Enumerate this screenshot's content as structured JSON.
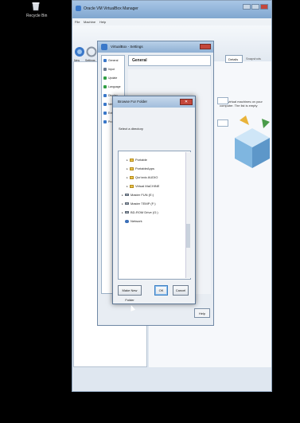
{
  "desktop": {
    "recycle_bin_label": "Recycle Bin"
  },
  "main_window": {
    "title": "Oracle VM VirtualBox Manager",
    "menu": [
      "File",
      "Machine",
      "Help"
    ],
    "toolbar": [
      {
        "label": "New",
        "icon": "new-vm-icon"
      },
      {
        "label": "Settings",
        "icon": "settings-gear-icon"
      }
    ],
    "details_tab": "Details",
    "snapshots_tab": "Snapshots",
    "welcome_text": "list of virtual machines on your computer. The list is empty"
  },
  "settings_dialog": {
    "title": "VirtualBox - Settings",
    "nav_items": [
      {
        "label": "General",
        "color": "#3a78c9"
      },
      {
        "label": "Input",
        "color": "#6a7b90"
      },
      {
        "label": "Update",
        "color": "#2f9e44"
      },
      {
        "label": "Language",
        "color": "#2f9e44"
      },
      {
        "label": "Display",
        "color": "#3a78c9"
      },
      {
        "label": "Network",
        "color": "#3a78c9"
      },
      {
        "label": "Extensions",
        "color": "#3a78c9"
      },
      {
        "label": "Proxy",
        "color": "#3a78c9"
      }
    ],
    "section_header": "General",
    "help_button": "Help"
  },
  "browse_dialog": {
    "title": "Browse For Folder",
    "prompt": "Select a directory",
    "tree": [
      {
        "label": "Portable",
        "type": "folder",
        "indent": 1
      },
      {
        "label": "PortableApps",
        "type": "folder",
        "indent": 1
      },
      {
        "label": "Qur'anic AUDIO",
        "type": "folder",
        "indent": 1
      },
      {
        "label": "Virtual MaCHINE",
        "type": "folder",
        "indent": 1
      },
      {
        "label": "Master FUN (E:)",
        "type": "drive",
        "indent": 0
      },
      {
        "label": "Master TEMP (F:)",
        "type": "drive",
        "indent": 0
      },
      {
        "label": "BD-ROM Drive (G:)",
        "type": "drive",
        "indent": 0
      },
      {
        "label": "Network",
        "type": "network",
        "indent": 0
      }
    ],
    "make_new_folder_button": "Make New Folder",
    "ok_button": "OK",
    "cancel_button": "Cancel"
  },
  "colors": {
    "desktop_bg": "#000000",
    "titlebar": "#8fb0d4",
    "close_red": "#c4473b",
    "folder_yellow": "#e8c34a"
  }
}
